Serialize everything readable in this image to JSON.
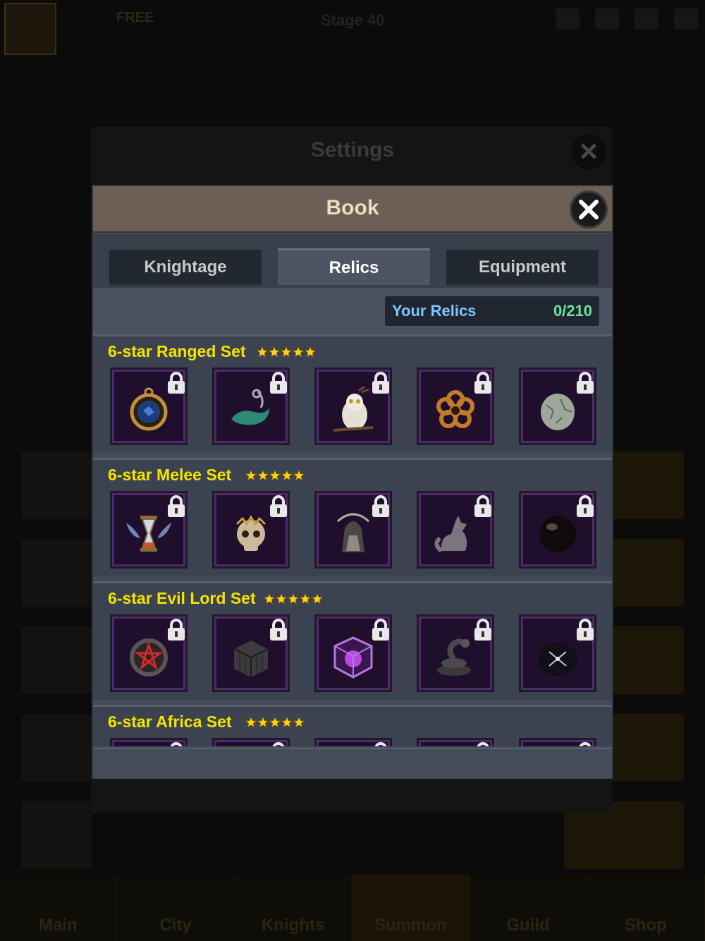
{
  "background": {
    "free_label": "FREE",
    "stage_label": "Stage 40",
    "nav": [
      "Main",
      "City",
      "Knights",
      "Summon",
      "Guild",
      "Shop"
    ]
  },
  "settings": {
    "title": "Settings"
  },
  "book": {
    "title": "Book",
    "tabs": [
      {
        "label": "Knightage",
        "active": false
      },
      {
        "label": "Relics",
        "active": true
      },
      {
        "label": "Equipment",
        "active": false
      }
    ],
    "your_relics_label": "Your Relics",
    "your_relics_value": "0/210",
    "sets": [
      {
        "title": "6-star Ranged Set",
        "stars": 5,
        "items": [
          "pocket-watch-icon",
          "whale-necklace-icon",
          "white-owl-icon",
          "flower-ring-icon",
          "stone-egg-icon"
        ]
      },
      {
        "title": "6-star Melee Set",
        "stars": 5,
        "items": [
          "winged-hourglass-icon",
          "crowned-skull-icon",
          "reaper-statue-icon",
          "stone-fox-icon",
          "black-orb-icon"
        ]
      },
      {
        "title": "6-star Evil Lord Set",
        "stars": 5,
        "items": [
          "pentagram-ring-icon",
          "dark-cube-icon",
          "purple-cage-icon",
          "coiled-snake-icon",
          "dark-gem-icon"
        ]
      },
      {
        "title": "6-star Africa Set",
        "stars": 5,
        "items": [
          "africa-relic-1-icon",
          "africa-relic-2-icon",
          "africa-relic-3-icon",
          "africa-relic-4-icon",
          "africa-relic-5-icon"
        ]
      }
    ]
  },
  "colors": {
    "set_title": "#f5e400",
    "relics_label": "#7cc6ff",
    "relics_value": "#6be39a",
    "item_frame": "#4f2970"
  }
}
